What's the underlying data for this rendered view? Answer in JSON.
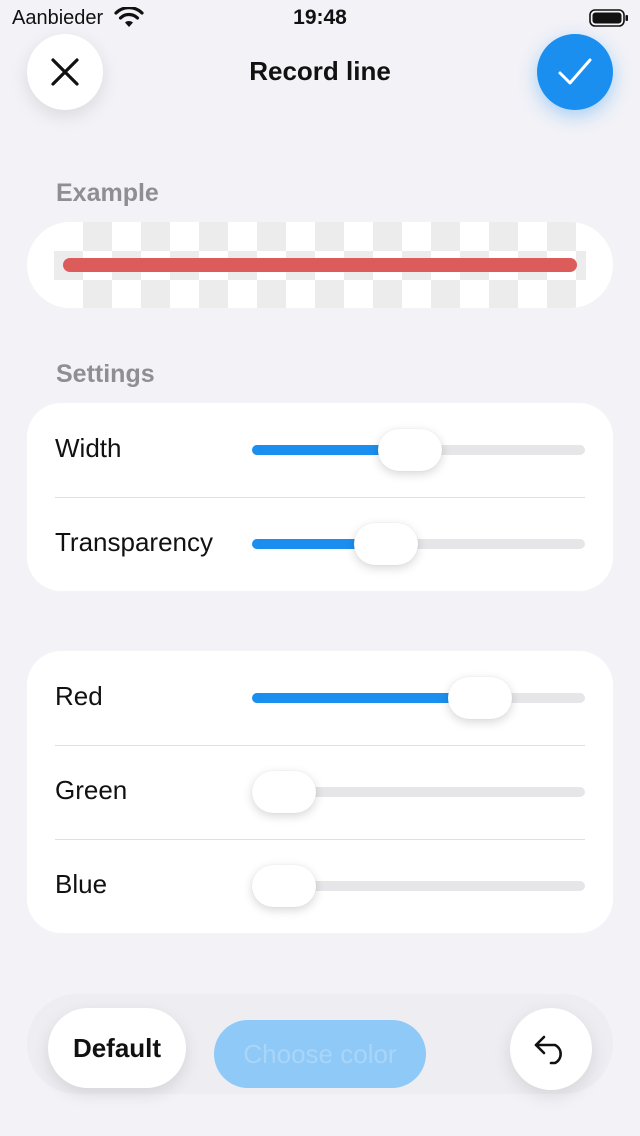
{
  "status_bar": {
    "carrier": "Aanbieder",
    "time": "19:48"
  },
  "nav": {
    "title": "Record line",
    "close_icon": "close-icon",
    "confirm_icon": "checkmark-icon"
  },
  "example": {
    "label": "Example",
    "line_color": "#dc5c5c"
  },
  "settings": {
    "label": "Settings",
    "sliders": [
      {
        "label": "Width",
        "value": 0.47
      },
      {
        "label": "Transparency",
        "value": 0.38
      }
    ]
  },
  "color": {
    "sliders": [
      {
        "label": "Red",
        "value": 0.73
      },
      {
        "label": "Green",
        "value": 0.0
      },
      {
        "label": "Blue",
        "value": 0.0
      }
    ]
  },
  "toolbar": {
    "default_label": "Default",
    "choose_color_label": "Choose color",
    "undo_icon": "undo-icon"
  },
  "colors": {
    "accent": "#1a8ff0",
    "background": "#f2f2f7"
  }
}
